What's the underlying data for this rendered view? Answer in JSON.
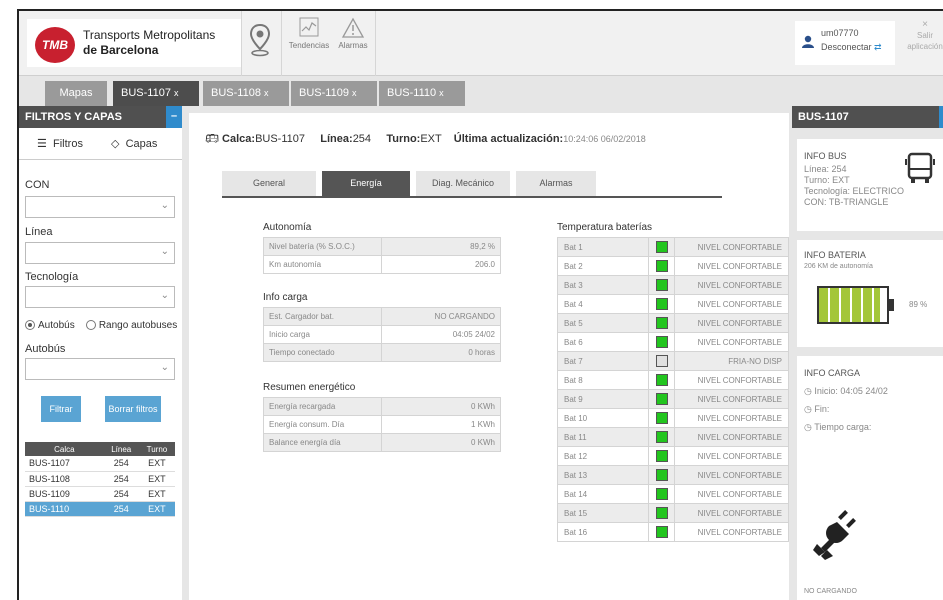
{
  "header": {
    "logo_mark": "TMB",
    "brand_line1": "Transports Metropolitans",
    "brand_line2": "de Barcelona",
    "trends_label": "Tendencias",
    "alarms_label": "Alarmas",
    "user_id": "um07770",
    "user_status": "Desconectar",
    "exit_label_1": "Salir",
    "exit_label_2": "aplicación"
  },
  "top_tabs": [
    {
      "label": "Mapas",
      "closable": false
    },
    {
      "label": "BUS-1107",
      "closable": true,
      "active": true
    },
    {
      "label": "BUS-1108",
      "closable": true
    },
    {
      "label": "BUS-1109",
      "closable": true
    },
    {
      "label": "BUS-1110",
      "closable": true
    }
  ],
  "left_panel": {
    "title": "FILTROS Y CAPAS",
    "tab_filters": "Filtros",
    "tab_layers": "Capas",
    "con_label": "CON",
    "linea_label": "Línea",
    "tecnologia_label": "Tecnología",
    "radio_autobus": "Autobús",
    "radio_rango": "Rango autobuses",
    "autobus_label": "Autobús",
    "filter_button": "Filtrar",
    "clear_button": "Borrar filtros",
    "table_headers": [
      "Calca",
      "Línea",
      "Turno"
    ],
    "rows": [
      [
        "BUS-1107",
        "254",
        "EXT"
      ],
      [
        "BUS-1108",
        "254",
        "EXT"
      ],
      [
        "BUS-1109",
        "254",
        "EXT"
      ],
      [
        "BUS-1110",
        "254",
        "EXT"
      ]
    ]
  },
  "bus_info": {
    "calca_label": "Calca:",
    "calca_value": "BUS-1107",
    "linea_label": "Línea:",
    "linea_value": "254",
    "turno_label": "Turno:",
    "turno_value": "EXT",
    "update_label": "Última actualización:",
    "update_value": "10:24:06  06/02/2018"
  },
  "center_tabs": [
    "General",
    "Energía",
    "Diag. Mecánico",
    "Alarmas"
  ],
  "autonomia": {
    "title": "Autonomía",
    "rows": [
      {
        "k": "Nivel batería (% S.O.C.)",
        "v": "89,2 %"
      },
      {
        "k": "Km autonomía",
        "v": "206.0"
      }
    ]
  },
  "info_carga_center": {
    "title": "Info carga",
    "rows": [
      {
        "k": "Est. Cargador bat.",
        "v": "NO CARGANDO"
      },
      {
        "k": "Inicio carga",
        "v": "04:05  24/02"
      },
      {
        "k": "Tiempo conectado",
        "v": "0 horas"
      }
    ]
  },
  "resumen": {
    "title": "Resumen energético",
    "rows": [
      {
        "k": "Energía recargada",
        "v": "0 KWh"
      },
      {
        "k": "Energía consum. Día",
        "v": "1 KWh"
      },
      {
        "k": "Balance energía día",
        "v": "0 KWh"
      }
    ]
  },
  "temperature": {
    "title": "Temperatura baterías",
    "ok_color": "#22c51e",
    "cold_color": "#e0e0e0",
    "rows": [
      {
        "bat": "Bat 1",
        "status": "NIVEL CONFORTABLE",
        "ok": true
      },
      {
        "bat": "Bat 2",
        "status": "NIVEL CONFORTABLE",
        "ok": true
      },
      {
        "bat": "Bat 3",
        "status": "NIVEL CONFORTABLE",
        "ok": true
      },
      {
        "bat": "Bat 4",
        "status": "NIVEL CONFORTABLE",
        "ok": true
      },
      {
        "bat": "Bat 5",
        "status": "NIVEL CONFORTABLE",
        "ok": true
      },
      {
        "bat": "Bat 6",
        "status": "NIVEL CONFORTABLE",
        "ok": true
      },
      {
        "bat": "Bat 7",
        "status": "FRIA-NO DISP",
        "ok": false
      },
      {
        "bat": "Bat 8",
        "status": "NIVEL CONFORTABLE",
        "ok": true
      },
      {
        "bat": "Bat 9",
        "status": "NIVEL CONFORTABLE",
        "ok": true
      },
      {
        "bat": "Bat 10",
        "status": "NIVEL CONFORTABLE",
        "ok": true
      },
      {
        "bat": "Bat 11",
        "status": "NIVEL CONFORTABLE",
        "ok": true
      },
      {
        "bat": "Bat 12",
        "status": "NIVEL CONFORTABLE",
        "ok": true
      },
      {
        "bat": "Bat 13",
        "status": "NIVEL CONFORTABLE",
        "ok": true
      },
      {
        "bat": "Bat 14",
        "status": "NIVEL CONFORTABLE",
        "ok": true
      },
      {
        "bat": "Bat 15",
        "status": "NIVEL CONFORTABLE",
        "ok": true
      },
      {
        "bat": "Bat 16",
        "status": "NIVEL CONFORTABLE",
        "ok": true
      }
    ]
  },
  "right_panel": {
    "title": "BUS-1107",
    "info_bus": {
      "title": "INFO BUS",
      "linea": "Línea: 254",
      "turno": "Turno: EXT",
      "tecnologia": "Tecnología: ELECTRICO",
      "con": "CON: TB-TRIANGLE"
    },
    "info_bateria": {
      "title": "INFO BATERIA",
      "autonomy": "206 KM de autonomía",
      "percent_text": "89 %",
      "level": 0.89,
      "color": "#a4c639"
    },
    "info_carga": {
      "title": "INFO CARGA",
      "inicio": "Inicio: 04:05  24/02",
      "fin": "Fin:",
      "tiempo": "Tiempo carga:",
      "status": "NO CARGANDO"
    }
  }
}
